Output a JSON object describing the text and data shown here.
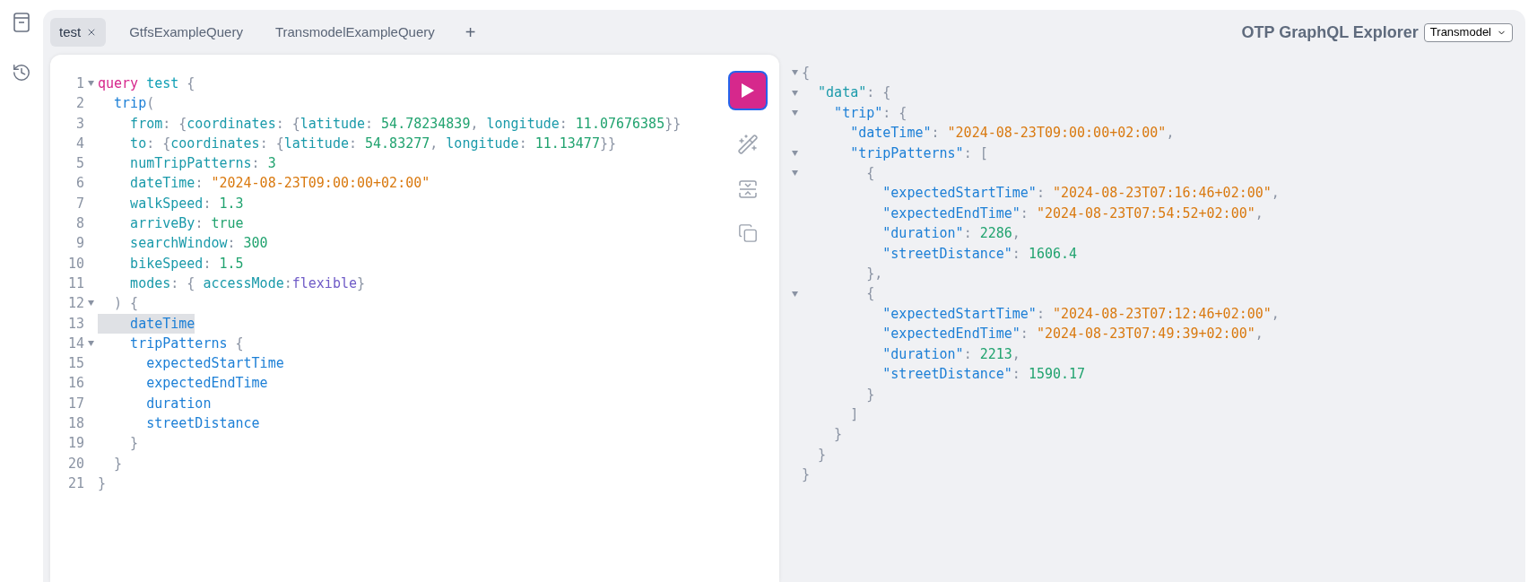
{
  "sidebar": {
    "items": [
      {
        "kind": "docs"
      },
      {
        "kind": "history"
      }
    ]
  },
  "tabs": [
    {
      "label": "test",
      "selected": true,
      "closable": true
    },
    {
      "label": "GtfsExampleQuery",
      "selected": false,
      "closable": false
    },
    {
      "label": "TransmodelExampleQuery",
      "selected": false,
      "closable": false
    }
  ],
  "add_tab": "+",
  "title": "OTP GraphQL Explorer",
  "api_select": {
    "value": "Transmodel"
  },
  "editor": {
    "lines": [
      {
        "number": "1",
        "foldable": true,
        "highlighted": false,
        "tokens": [
          {
            "kind": "keyword",
            "text": "query"
          },
          {
            "kind": "name",
            "text": " test"
          },
          {
            "kind": "punct",
            "text": " {"
          }
        ]
      },
      {
        "number": "2",
        "foldable": false,
        "highlighted": false,
        "tokens": [
          {
            "kind": "field",
            "text": "  trip"
          },
          {
            "kind": "punct",
            "text": "("
          }
        ]
      },
      {
        "number": "3",
        "foldable": false,
        "highlighted": false,
        "tokens": [
          {
            "kind": "arg",
            "text": "    from"
          },
          {
            "kind": "punct",
            "text": ": {"
          },
          {
            "kind": "arg",
            "text": "coordinates"
          },
          {
            "kind": "punct",
            "text": ": {"
          },
          {
            "kind": "arg",
            "text": "latitude"
          },
          {
            "kind": "punct",
            "text": ": "
          },
          {
            "kind": "number",
            "text": "54.78234839"
          },
          {
            "kind": "punct",
            "text": ", "
          },
          {
            "kind": "arg",
            "text": "longitude"
          },
          {
            "kind": "punct",
            "text": ": "
          },
          {
            "kind": "number",
            "text": "11.07676385"
          },
          {
            "kind": "punct",
            "text": "}}"
          }
        ]
      },
      {
        "number": "4",
        "foldable": false,
        "highlighted": false,
        "tokens": [
          {
            "kind": "arg",
            "text": "    to"
          },
          {
            "kind": "punct",
            "text": ": {"
          },
          {
            "kind": "arg",
            "text": "coordinates"
          },
          {
            "kind": "punct",
            "text": ": {"
          },
          {
            "kind": "arg",
            "text": "latitude"
          },
          {
            "kind": "punct",
            "text": ": "
          },
          {
            "kind": "number",
            "text": "54.83277"
          },
          {
            "kind": "punct",
            "text": ", "
          },
          {
            "kind": "arg",
            "text": "longitude"
          },
          {
            "kind": "punct",
            "text": ": "
          },
          {
            "kind": "number",
            "text": "11.13477"
          },
          {
            "kind": "punct",
            "text": "}}"
          }
        ]
      },
      {
        "number": "5",
        "foldable": false,
        "highlighted": false,
        "tokens": [
          {
            "kind": "arg",
            "text": "    numTripPatterns"
          },
          {
            "kind": "punct",
            "text": ": "
          },
          {
            "kind": "number",
            "text": "3"
          }
        ]
      },
      {
        "number": "6",
        "foldable": false,
        "highlighted": false,
        "tokens": [
          {
            "kind": "arg",
            "text": "    dateTime"
          },
          {
            "kind": "punct",
            "text": ": "
          },
          {
            "kind": "string",
            "text": "\"2024-08-23T09:00:00+02:00\""
          }
        ]
      },
      {
        "number": "7",
        "foldable": false,
        "highlighted": false,
        "tokens": [
          {
            "kind": "arg",
            "text": "    walkSpeed"
          },
          {
            "kind": "punct",
            "text": ": "
          },
          {
            "kind": "number",
            "text": "1.3"
          }
        ]
      },
      {
        "number": "8",
        "foldable": false,
        "highlighted": false,
        "tokens": [
          {
            "kind": "arg",
            "text": "    arriveBy"
          },
          {
            "kind": "punct",
            "text": ": "
          },
          {
            "kind": "number",
            "text": "true"
          }
        ]
      },
      {
        "number": "9",
        "foldable": false,
        "highlighted": false,
        "tokens": [
          {
            "kind": "arg",
            "text": "    searchWindow"
          },
          {
            "kind": "punct",
            "text": ": "
          },
          {
            "kind": "number",
            "text": "300"
          }
        ]
      },
      {
        "number": "10",
        "foldable": false,
        "highlighted": false,
        "tokens": [
          {
            "kind": "arg",
            "text": "    bikeSpeed"
          },
          {
            "kind": "punct",
            "text": ": "
          },
          {
            "kind": "number",
            "text": "1.5"
          }
        ]
      },
      {
        "number": "11",
        "foldable": false,
        "highlighted": false,
        "tokens": [
          {
            "kind": "arg",
            "text": "    modes"
          },
          {
            "kind": "punct",
            "text": ": { "
          },
          {
            "kind": "arg",
            "text": "accessMode"
          },
          {
            "kind": "punct",
            "text": ":"
          },
          {
            "kind": "enum",
            "text": "flexible"
          },
          {
            "kind": "punct",
            "text": "}"
          }
        ]
      },
      {
        "number": "12",
        "foldable": true,
        "highlighted": false,
        "tokens": [
          {
            "kind": "punct",
            "text": "  ) {"
          }
        ]
      },
      {
        "number": "13",
        "foldable": false,
        "highlighted": true,
        "tokens": [
          {
            "kind": "field",
            "text": "    dateTime"
          }
        ]
      },
      {
        "number": "14",
        "foldable": true,
        "highlighted": false,
        "tokens": [
          {
            "kind": "field",
            "text": "    tripPatterns"
          },
          {
            "kind": "punct",
            "text": " {"
          }
        ]
      },
      {
        "number": "15",
        "foldable": false,
        "highlighted": false,
        "tokens": [
          {
            "kind": "field",
            "text": "      expectedStartTime"
          }
        ]
      },
      {
        "number": "16",
        "foldable": false,
        "highlighted": false,
        "tokens": [
          {
            "kind": "field",
            "text": "      expectedEndTime"
          }
        ]
      },
      {
        "number": "17",
        "foldable": false,
        "highlighted": false,
        "tokens": [
          {
            "kind": "field",
            "text": "      duration"
          }
        ]
      },
      {
        "number": "18",
        "foldable": false,
        "highlighted": false,
        "tokens": [
          {
            "kind": "field",
            "text": "      streetDistance"
          }
        ]
      },
      {
        "number": "19",
        "foldable": false,
        "highlighted": false,
        "tokens": [
          {
            "kind": "punct",
            "text": "    }"
          }
        ]
      },
      {
        "number": "20",
        "foldable": false,
        "highlighted": false,
        "tokens": [
          {
            "kind": "punct",
            "text": "  }"
          }
        ]
      },
      {
        "number": "21",
        "foldable": false,
        "highlighted": false,
        "tokens": [
          {
            "kind": "punct",
            "text": "}"
          }
        ]
      }
    ]
  },
  "toolbar": [
    {
      "kind": "run"
    },
    {
      "kind": "prettify"
    },
    {
      "kind": "merge"
    },
    {
      "kind": "copy"
    }
  ],
  "result": {
    "lines": [
      {
        "foldable": true,
        "tokens": [
          {
            "kind": "punct",
            "text": "{"
          }
        ]
      },
      {
        "foldable": true,
        "tokens": [
          {
            "kind": "arg",
            "text": "  \"data\""
          },
          {
            "kind": "punct",
            "text": ": {"
          }
        ]
      },
      {
        "foldable": true,
        "tokens": [
          {
            "kind": "field",
            "text": "    \"trip\""
          },
          {
            "kind": "punct",
            "text": ": {"
          }
        ]
      },
      {
        "foldable": false,
        "tokens": [
          {
            "kind": "field",
            "text": "      \"dateTime\""
          },
          {
            "kind": "punct",
            "text": ": "
          },
          {
            "kind": "string",
            "text": "\"2024-08-23T09:00:00+02:00\""
          },
          {
            "kind": "punct",
            "text": ","
          }
        ]
      },
      {
        "foldable": true,
        "tokens": [
          {
            "kind": "field",
            "text": "      \"tripPatterns\""
          },
          {
            "kind": "punct",
            "text": ": ["
          }
        ]
      },
      {
        "foldable": true,
        "tokens": [
          {
            "kind": "punct",
            "text": "        {"
          }
        ]
      },
      {
        "foldable": false,
        "tokens": [
          {
            "kind": "field",
            "text": "          \"expectedStartTime\""
          },
          {
            "kind": "punct",
            "text": ": "
          },
          {
            "kind": "string",
            "text": "\"2024-08-23T07:16:46+02:00\""
          },
          {
            "kind": "punct",
            "text": ","
          }
        ]
      },
      {
        "foldable": false,
        "tokens": [
          {
            "kind": "field",
            "text": "          \"expectedEndTime\""
          },
          {
            "kind": "punct",
            "text": ": "
          },
          {
            "kind": "string",
            "text": "\"2024-08-23T07:54:52+02:00\""
          },
          {
            "kind": "punct",
            "text": ","
          }
        ]
      },
      {
        "foldable": false,
        "tokens": [
          {
            "kind": "field",
            "text": "          \"duration\""
          },
          {
            "kind": "punct",
            "text": ": "
          },
          {
            "kind": "number",
            "text": "2286"
          },
          {
            "kind": "punct",
            "text": ","
          }
        ]
      },
      {
        "foldable": false,
        "tokens": [
          {
            "kind": "field",
            "text": "          \"streetDistance\""
          },
          {
            "kind": "punct",
            "text": ": "
          },
          {
            "kind": "number",
            "text": "1606.4"
          }
        ]
      },
      {
        "foldable": false,
        "tokens": [
          {
            "kind": "punct",
            "text": "        },"
          }
        ]
      },
      {
        "foldable": true,
        "tokens": [
          {
            "kind": "punct",
            "text": "        {"
          }
        ]
      },
      {
        "foldable": false,
        "tokens": [
          {
            "kind": "field",
            "text": "          \"expectedStartTime\""
          },
          {
            "kind": "punct",
            "text": ": "
          },
          {
            "kind": "string",
            "text": "\"2024-08-23T07:12:46+02:00\""
          },
          {
            "kind": "punct",
            "text": ","
          }
        ]
      },
      {
        "foldable": false,
        "tokens": [
          {
            "kind": "field",
            "text": "          \"expectedEndTime\""
          },
          {
            "kind": "punct",
            "text": ": "
          },
          {
            "kind": "string",
            "text": "\"2024-08-23T07:49:39+02:00\""
          },
          {
            "kind": "punct",
            "text": ","
          }
        ]
      },
      {
        "foldable": false,
        "tokens": [
          {
            "kind": "field",
            "text": "          \"duration\""
          },
          {
            "kind": "punct",
            "text": ": "
          },
          {
            "kind": "number",
            "text": "2213"
          },
          {
            "kind": "punct",
            "text": ","
          }
        ]
      },
      {
        "foldable": false,
        "tokens": [
          {
            "kind": "field",
            "text": "          \"streetDistance\""
          },
          {
            "kind": "punct",
            "text": ": "
          },
          {
            "kind": "number",
            "text": "1590.17"
          }
        ]
      },
      {
        "foldable": false,
        "tokens": [
          {
            "kind": "punct",
            "text": "        }"
          }
        ]
      },
      {
        "foldable": false,
        "tokens": [
          {
            "kind": "punct",
            "text": "      ]"
          }
        ]
      },
      {
        "foldable": false,
        "tokens": [
          {
            "kind": "punct",
            "text": "    }"
          }
        ]
      },
      {
        "foldable": false,
        "tokens": [
          {
            "kind": "punct",
            "text": "  }"
          }
        ]
      },
      {
        "foldable": false,
        "tokens": [
          {
            "kind": "punct",
            "text": "}"
          }
        ]
      }
    ]
  }
}
